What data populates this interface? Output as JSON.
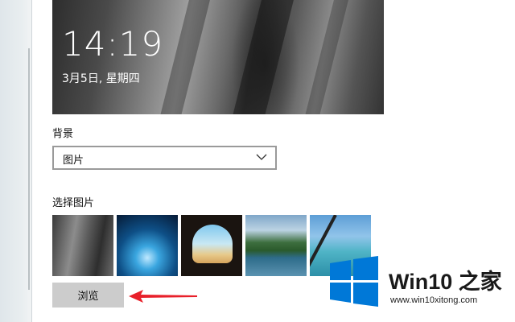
{
  "lockscreen_preview": {
    "time": "14:19",
    "date": "3月5日, 星期四"
  },
  "background_section": {
    "label": "背景",
    "dropdown_value": "图片"
  },
  "choose_picture_section": {
    "label": "选择图片",
    "thumbnails": [
      "rock-cliff-photo",
      "ice-cave-photo",
      "sea-cave-arch-photo",
      "mountain-lake-photo",
      "airplane-wing-ocean-photo"
    ],
    "browse_label": "浏览"
  },
  "watermark": {
    "title": "Win10 之家",
    "url": "www.win10xitong.com"
  },
  "colors": {
    "accent": "#0078d7",
    "annotation_arrow": "#e8202a"
  }
}
